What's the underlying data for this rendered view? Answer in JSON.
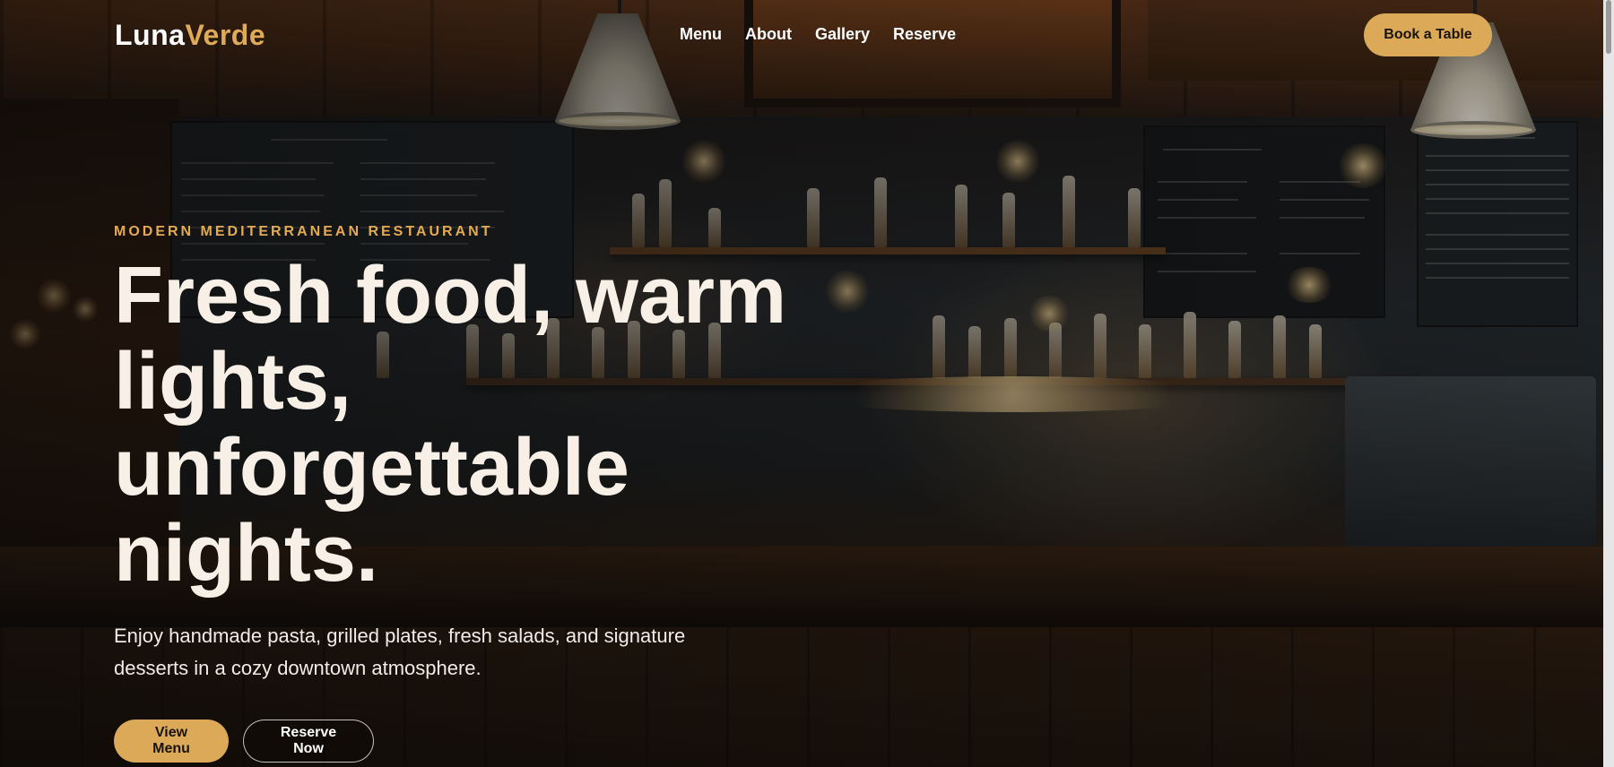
{
  "brand": {
    "logo_part1": "Luna",
    "logo_part2": "Verde",
    "accent_color": "#dba957"
  },
  "nav": {
    "links": [
      "Menu",
      "About",
      "Gallery",
      "Reserve"
    ],
    "cta_label": "Book a Table"
  },
  "hero": {
    "eyebrow": "MODERN MEDITERRANEAN RESTAURANT",
    "headline": "Fresh food, warm lights, unforgettable nights.",
    "subtitle": "Enjoy handmade pasta, grilled plates, fresh salads, and signature desserts in a cozy downtown atmosphere.",
    "primary_button": "View Menu",
    "secondary_button": "Reserve Now"
  },
  "background": {
    "scene": "dimly lit bar with bottles, chalkboard menus and pendant lamps"
  }
}
